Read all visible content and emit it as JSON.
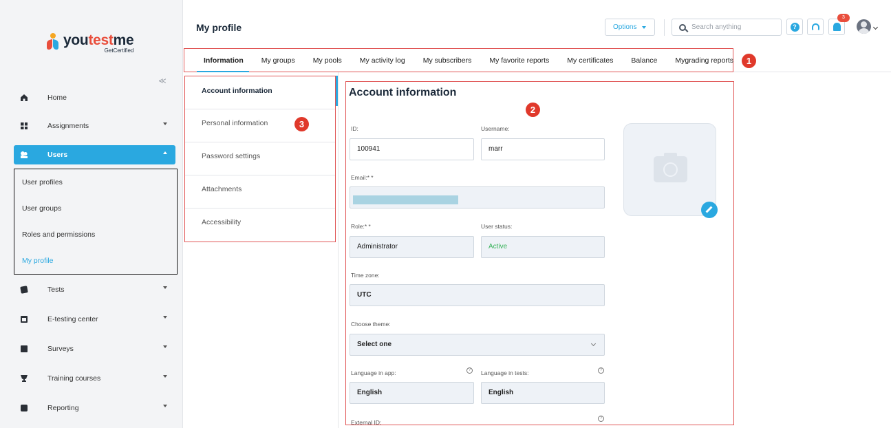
{
  "app": {
    "logo_prefix": "you",
    "logo_accent": "test",
    "logo_suffix": "me",
    "logo_tagline": "GetCertified",
    "brand_color": "#2aa8e0",
    "annotation_color": "#e0392b"
  },
  "sidebar": {
    "collapse_icon": "double-chevron-left-icon",
    "collapse_glyph": "≪",
    "items": [
      {
        "label": "Home",
        "icon": "home-icon"
      },
      {
        "label": "Assignments",
        "icon": "assignments-icon"
      },
      {
        "label": "Users",
        "icon": "users-icon",
        "active": true
      },
      {
        "label": "Tests",
        "icon": "tests-icon"
      },
      {
        "label": "E-testing center",
        "icon": "calendar-icon"
      },
      {
        "label": "Surveys",
        "icon": "surveys-icon"
      },
      {
        "label": "Training courses",
        "icon": "trophy-icon"
      },
      {
        "label": "Reporting",
        "icon": "reporting-icon"
      }
    ],
    "users_submenu": [
      {
        "label": "User profiles"
      },
      {
        "label": "User groups"
      },
      {
        "label": "Roles and permissions"
      },
      {
        "label": "My profile",
        "current": true
      }
    ]
  },
  "header": {
    "page_title": "My profile",
    "options_label": "Options",
    "search_placeholder": "Search anything",
    "help_glyph": "?",
    "notification_count": "3"
  },
  "tabs": [
    {
      "label": "Information",
      "active": true
    },
    {
      "label": "My groups"
    },
    {
      "label": "My pools"
    },
    {
      "label": "My activity log"
    },
    {
      "label": "My subscribers"
    },
    {
      "label": "My favorite reports"
    },
    {
      "label": "My certificates"
    },
    {
      "label": "Balance"
    },
    {
      "label": "Mygrading reports"
    }
  ],
  "subnav": [
    {
      "label": "Account information",
      "active": true
    },
    {
      "label": "Personal information"
    },
    {
      "label": "Password settings"
    },
    {
      "label": "Attachments"
    },
    {
      "label": "Accessibility"
    }
  ],
  "callouts": [
    "1",
    "2",
    "3"
  ],
  "form": {
    "title": "Account information",
    "id_label": "ID:",
    "id_value": "100941",
    "username_label": "Username:",
    "username_value": "marr",
    "email_label": "Email:* *",
    "role_label": "Role:* *",
    "role_value": "Administrator",
    "status_label": "User status:",
    "status_value": "Active",
    "timezone_label": "Time zone:",
    "timezone_value": "UTC",
    "theme_label": "Choose theme:",
    "theme_value": "Select one",
    "lang_app_label": "Language in app:",
    "lang_app_value": "English",
    "lang_tests_label": "Language in tests:",
    "lang_tests_value": "English",
    "external_id_label": "External ID:",
    "info_glyph": "?"
  }
}
